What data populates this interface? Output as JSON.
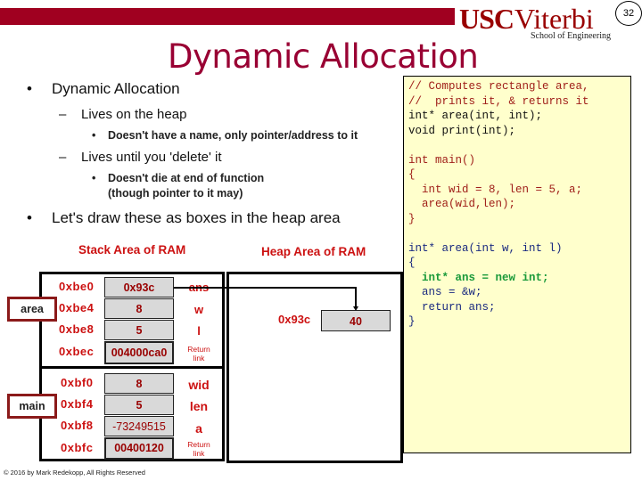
{
  "header": {
    "logo_usc": "USC",
    "logo_viterbi": "Viterbi",
    "logo_school": "School of Engineering",
    "page_number": "32",
    "title": "Dynamic Allocation",
    "brand_color": "#a00020"
  },
  "bullets": [
    {
      "level": 1,
      "marker": "•",
      "text": "Dynamic Allocation"
    },
    {
      "level": 2,
      "marker": "–",
      "text": "Lives on the heap"
    },
    {
      "level": 3,
      "marker": "•",
      "text": "Doesn't have a name, only pointer/address to it"
    },
    {
      "level": 2,
      "marker": "–",
      "text": "Lives until you 'delete' it"
    },
    {
      "level": 3,
      "marker": "•",
      "text": "Doesn't die at end of function"
    },
    {
      "level": 3,
      "marker": "",
      "text": "(though pointer to it may)"
    },
    {
      "level": 1,
      "marker": "•",
      "text": "Let's draw these as boxes in the heap area"
    }
  ],
  "code": {
    "lines": [
      {
        "text": "// Computes rectangle area,",
        "style": "red"
      },
      {
        "text": "//  prints it, & returns it",
        "style": "red"
      },
      {
        "text": "int* area(int, int);",
        "style": "dark"
      },
      {
        "text": "void print(int);",
        "style": "dark"
      },
      {
        "text": "",
        "style": "dark"
      },
      {
        "text": "int main()",
        "style": "red"
      },
      {
        "text": "{",
        "style": "red"
      },
      {
        "text": "  int wid = 8, len = 5, a;",
        "style": "red"
      },
      {
        "text": "  area(wid,len);",
        "style": "red"
      },
      {
        "text": "}",
        "style": "red"
      },
      {
        "text": "",
        "style": "dark"
      },
      {
        "text": "int* area(int w, int l)",
        "style": "blue"
      },
      {
        "text": "{",
        "style": "blue"
      },
      {
        "text": "  int* ans = new int;",
        "style": "green"
      },
      {
        "text": "  ans = &w;",
        "style": "blue"
      },
      {
        "text": "  return ans;",
        "style": "blue"
      },
      {
        "text": "}",
        "style": "blue"
      }
    ]
  },
  "diagram": {
    "stack_label": "Stack Area of RAM",
    "heap_label": "Heap Area of RAM",
    "frames": [
      {
        "name": "area",
        "rows": [
          {
            "addr": "0xbe0",
            "value": "0x93c",
            "var": "ans",
            "var_strike": true
          },
          {
            "addr": "0xbe4",
            "value": "8",
            "var": "w"
          },
          {
            "addr": "0xbe8",
            "value": "5",
            "var": "l"
          },
          {
            "addr": "0xbec",
            "value": "004000ca0",
            "var": "Return link"
          }
        ]
      },
      {
        "name": "main",
        "rows": [
          {
            "addr": "0xbf0",
            "value": "8",
            "var": "wid"
          },
          {
            "addr": "0xbf4",
            "value": "5",
            "var": "len"
          },
          {
            "addr": "0xbf8",
            "value": "-73249515",
            "var": "a"
          },
          {
            "addr": "0xbfc",
            "value": "00400120",
            "var": "Return link"
          }
        ]
      }
    ],
    "heap": {
      "addr": "0x93c",
      "value": "40"
    }
  },
  "footer": "© 2016 by Mark Redekopp, All Rights Reserved"
}
